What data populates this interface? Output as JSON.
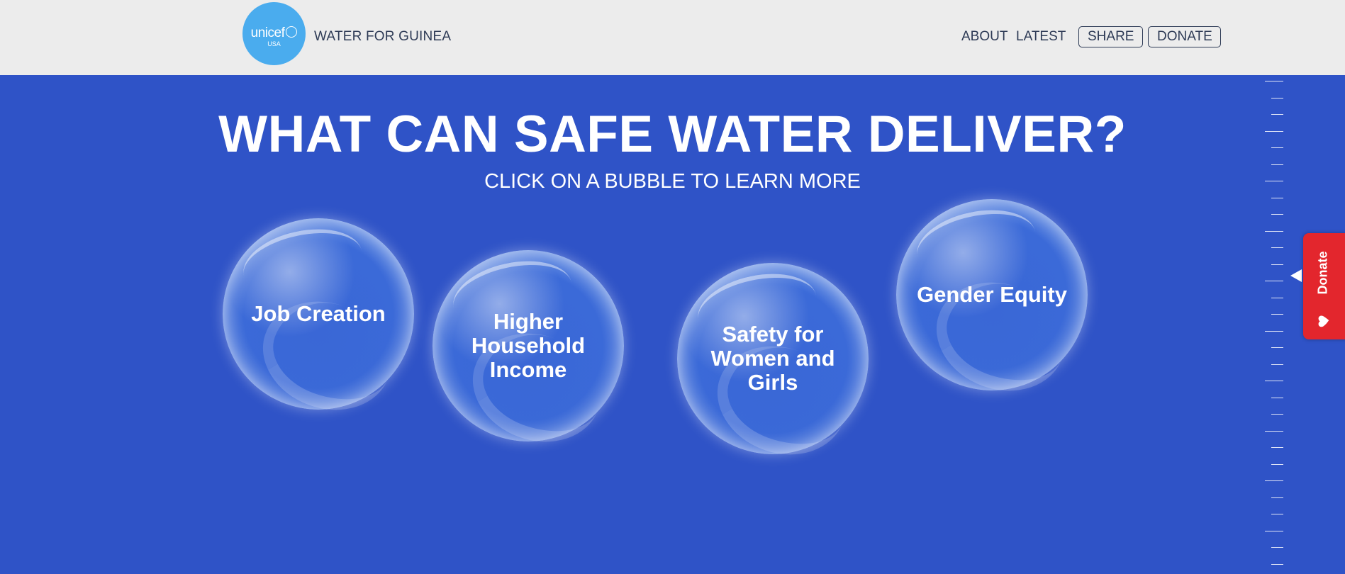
{
  "header": {
    "logo": {
      "word": "unicef",
      "sub": "USA"
    },
    "site_title": "WATER FOR GUINEA",
    "nav": {
      "about": "ABOUT",
      "latest": "LATEST"
    },
    "buttons": {
      "share": "SHARE",
      "donate": "DONATE"
    }
  },
  "main": {
    "headline": "WHAT CAN SAFE WATER DELIVER?",
    "subline": "CLICK ON A BUBBLE TO LEARN MORE",
    "bubbles": [
      {
        "label": "Job Creation"
      },
      {
        "label": "Higher\nHousehold\nIncome"
      },
      {
        "label": "Safety for\nWomen and\nGirls"
      },
      {
        "label": "Gender Equity"
      }
    ]
  },
  "donate_tab": {
    "label": "Donate",
    "icon": "heart-icon"
  },
  "colors": {
    "header_bg": "#ececec",
    "page_bg": "#2f53c7",
    "logo_bg": "#4aacee",
    "donate_tab_bg": "#e3262d"
  }
}
